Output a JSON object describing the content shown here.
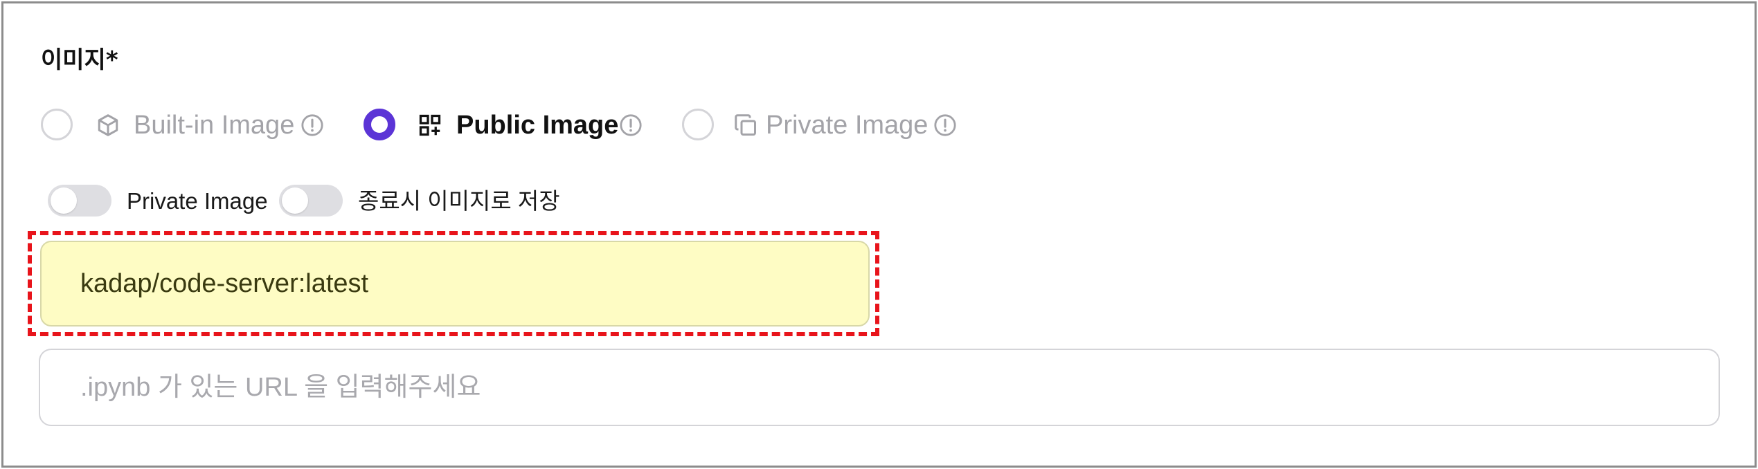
{
  "section": {
    "title": "이미지*"
  },
  "image_type_options": [
    {
      "label": "Built-in Image",
      "icon": "cube-icon",
      "selected": false
    },
    {
      "label": "Public Image",
      "icon": "grid-plus-icon",
      "selected": true
    },
    {
      "label": "Private Image",
      "icon": "copy-stack-icon",
      "selected": false
    }
  ],
  "toggles": [
    {
      "label": "Private Image",
      "on": false
    },
    {
      "label": "종료시 이미지로 저장",
      "on": false
    }
  ],
  "image_input": {
    "value": "kadap/code-server:latest"
  },
  "url_input": {
    "value": "",
    "placeholder": ".ipynb 가 있는 URL 을 입력해주세요"
  },
  "colors": {
    "accent": "#5b34d6",
    "highlight_border": "#e8141b",
    "highlight_fill": "#fefcc4",
    "disabled_text": "#a3a3a8"
  }
}
